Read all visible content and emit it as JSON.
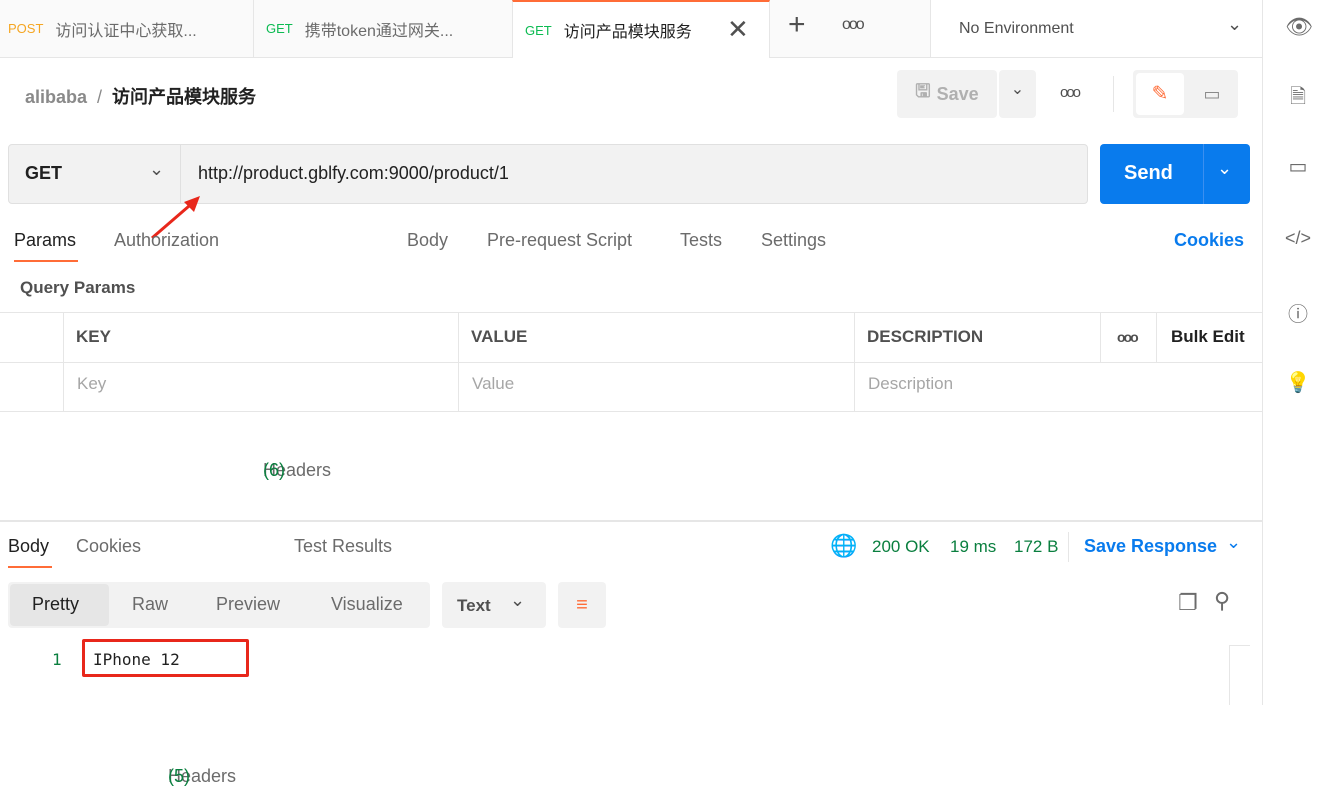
{
  "tabs": [
    {
      "method": "POST",
      "title": "访问认证中心获取...",
      "color": "#f5a623"
    },
    {
      "method": "GET",
      "title": "携带token通过网关...",
      "color": "#0cbb52"
    },
    {
      "method": "GET",
      "title": "访问产品模块服务",
      "color": "#0cbb52"
    }
  ],
  "environment": "No Environment",
  "breadcrumb": {
    "collection": "alibaba",
    "request": "访问产品模块服务"
  },
  "toolbar": {
    "save": "Save"
  },
  "request": {
    "method": "GET",
    "url": "http://product.gblfy.com:9000/product/1",
    "send": "Send"
  },
  "req_tabs": {
    "params": "Params",
    "auth": "Authorization",
    "headers": "Headers",
    "headers_count": "(6)",
    "body": "Body",
    "prerequest": "Pre-request Script",
    "tests": "Tests",
    "settings": "Settings",
    "cookies": "Cookies"
  },
  "params": {
    "title": "Query Params",
    "key": "KEY",
    "value": "VALUE",
    "description": "DESCRIPTION",
    "bulk": "Bulk Edit",
    "key_ph": "Key",
    "value_ph": "Value",
    "desc_ph": "Description"
  },
  "response": {
    "tabs": {
      "body": "Body",
      "cookies": "Cookies",
      "headers": "Headers",
      "headers_count": "(5)",
      "tests": "Test Results"
    },
    "status": "200 OK",
    "time": "19 ms",
    "size": "172 B",
    "save": "Save Response",
    "views": [
      "Pretty",
      "Raw",
      "Preview",
      "Visualize"
    ],
    "format": "Text",
    "lines": [
      {
        "num": "1",
        "text": "IPhone 12"
      }
    ]
  },
  "colors": {
    "accent": "#ff6c37",
    "primary": "#097bed",
    "success": "#0a7f3f"
  }
}
